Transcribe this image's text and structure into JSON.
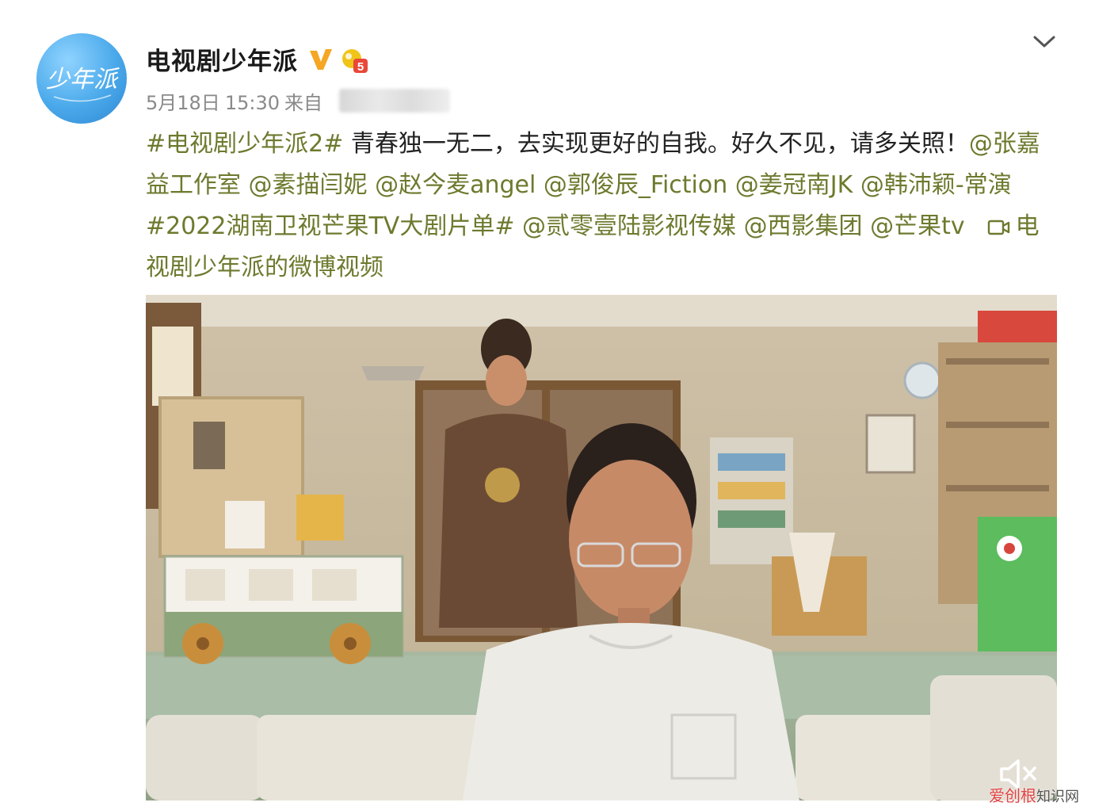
{
  "account": {
    "name": "电视剧少年派",
    "avatar_text": "少年派"
  },
  "post": {
    "date": "5月18日",
    "time": "15:30",
    "source_prefix": "来自",
    "segments": [
      {
        "text": "#电视剧少年派2#",
        "kind": "link"
      },
      {
        "text": " 青春独一无二，去实现更好的自我。好久不见，请多关照！",
        "kind": "plain"
      },
      {
        "text": "@张嘉益工作室",
        "kind": "link"
      },
      {
        "text": " ",
        "kind": "plain"
      },
      {
        "text": "@素描闫妮",
        "kind": "link"
      },
      {
        "text": " ",
        "kind": "plain"
      },
      {
        "text": "@赵今麦angel",
        "kind": "link"
      },
      {
        "text": " ",
        "kind": "plain"
      },
      {
        "text": "@郭俊辰_Fiction",
        "kind": "link"
      },
      {
        "text": " ",
        "kind": "plain"
      },
      {
        "text": "@姜冠南JK",
        "kind": "link"
      },
      {
        "text": " ",
        "kind": "plain"
      },
      {
        "text": "@韩沛颖-常演",
        "kind": "link"
      },
      {
        "text": " ",
        "kind": "plain"
      },
      {
        "text": "#2022湖南卫视芒果TV大剧片单#",
        "kind": "link"
      },
      {
        "text": " ",
        "kind": "plain"
      },
      {
        "text": "@贰零壹陆影视传媒",
        "kind": "link"
      },
      {
        "text": " ",
        "kind": "plain"
      },
      {
        "text": "@西影集团",
        "kind": "link"
      },
      {
        "text": " ",
        "kind": "plain"
      },
      {
        "text": "@芒果tv",
        "kind": "link"
      }
    ],
    "video_link": "电视剧少年派的微博视频"
  },
  "icons": {
    "verified": "verified-v-icon",
    "level": "member-level-icon",
    "more": "chevron-down-icon",
    "video": "video-camera-icon",
    "mute": "speaker-muted-icon"
  },
  "colors": {
    "link": "#6d7a2e",
    "verified": "#f5a623",
    "avatar": "#4aa9ea"
  },
  "watermark": {
    "brand": "爱创根",
    "site": "知识网"
  }
}
